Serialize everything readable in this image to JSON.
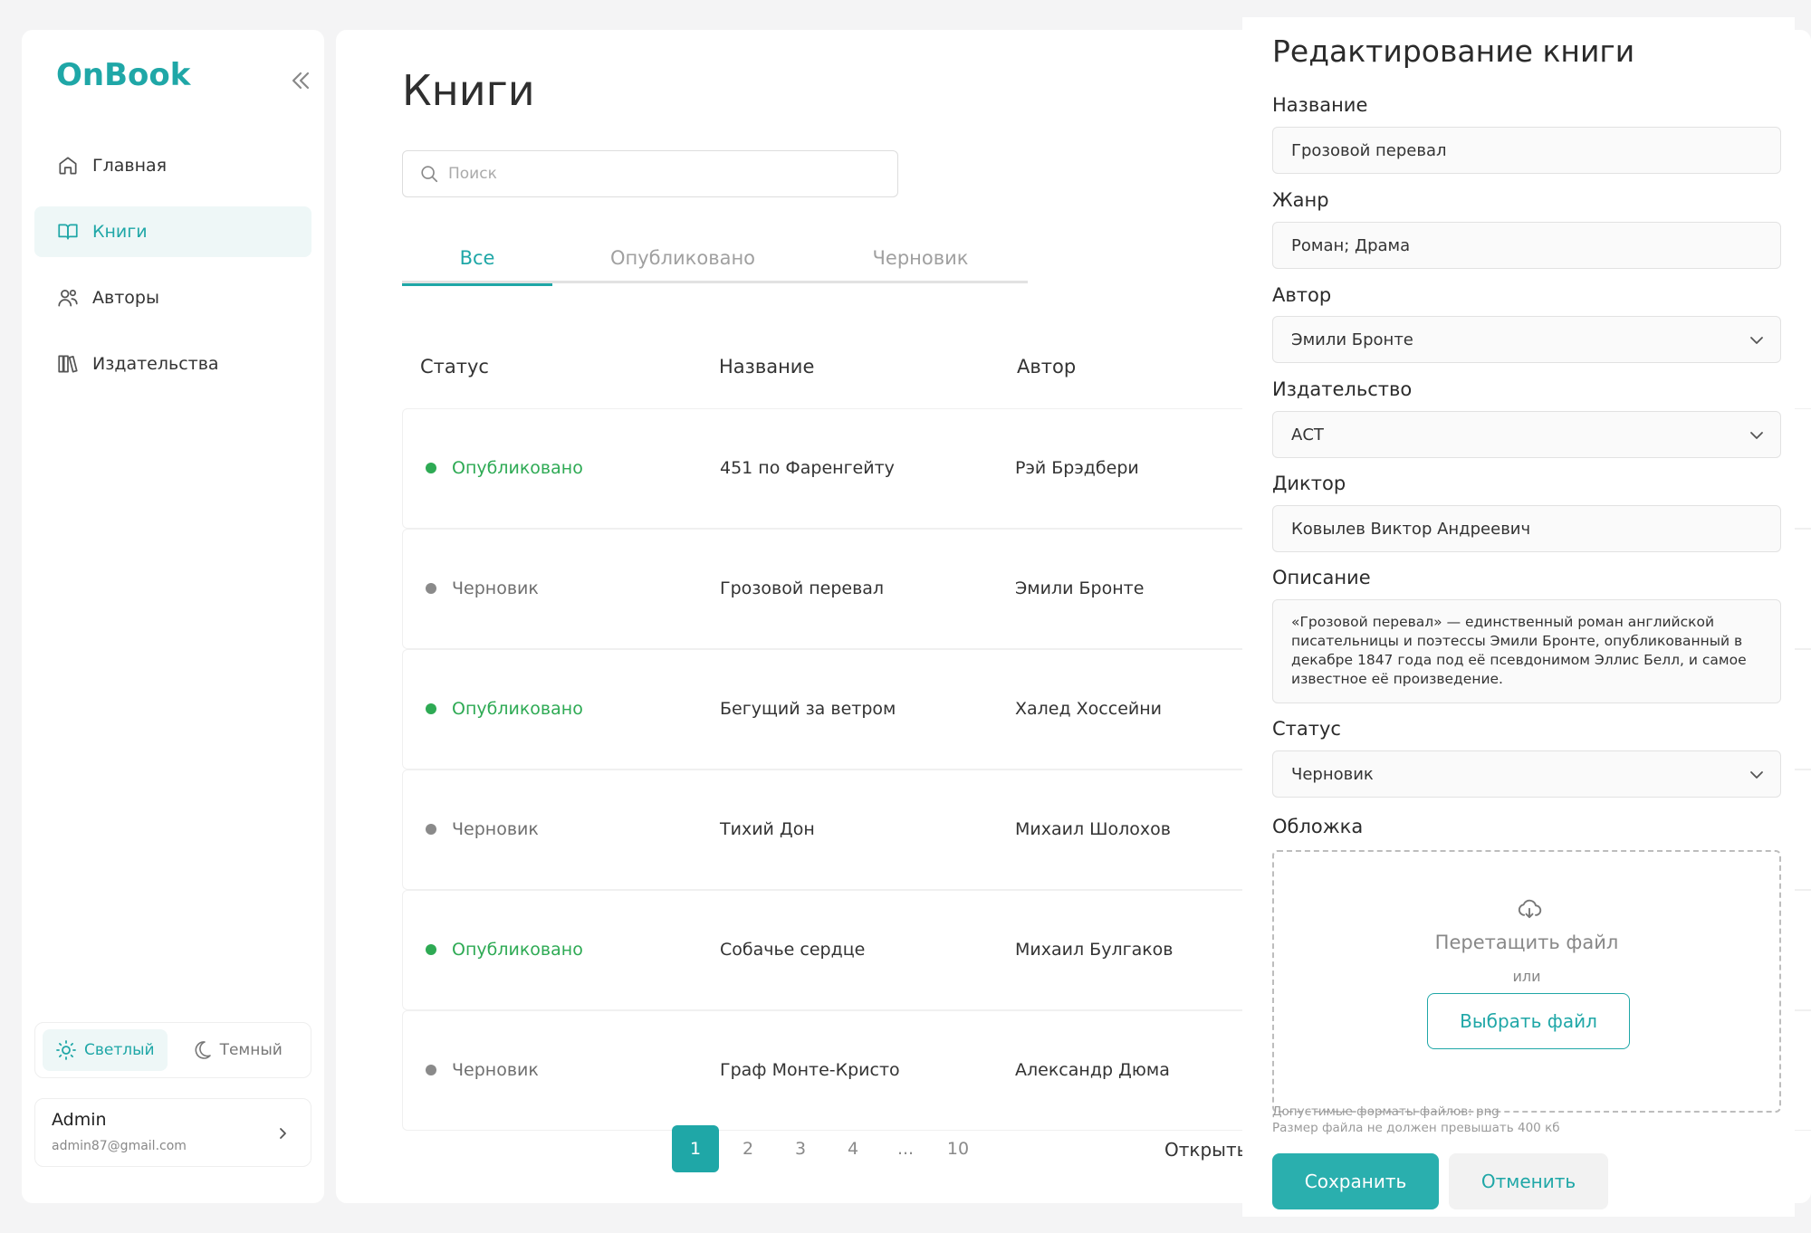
{
  "brand": {
    "name": "OnBook"
  },
  "sidebar": {
    "items": [
      {
        "label": "Главная",
        "icon": "home-icon"
      },
      {
        "label": "Книги",
        "icon": "book-icon"
      },
      {
        "label": "Авторы",
        "icon": "users-icon"
      },
      {
        "label": "Издательства",
        "icon": "library-icon"
      }
    ],
    "active_item": "Книги"
  },
  "theme": {
    "light": "Светлый",
    "dark": "Темный",
    "active": "Светлый"
  },
  "user": {
    "name": "Admin",
    "email": "admin87@gmail.com"
  },
  "main": {
    "title": "Книги",
    "search_placeholder": "Поиск",
    "tabs": [
      {
        "label": "Все"
      },
      {
        "label": "Опубликовано"
      },
      {
        "label": "Черновик"
      }
    ],
    "active_tab": "Все",
    "columns": [
      "Статус",
      "Название",
      "Автор"
    ],
    "rows": [
      {
        "status": "Опубликовано",
        "title": "451 по Фаренгейту",
        "author": "Рэй Брэдбери"
      },
      {
        "status": "Черновик",
        "title": "Грозовой перевал",
        "author": "Эмили Бронте"
      },
      {
        "status": "Опубликовано",
        "title": "Бегущий за ветром",
        "author": "Халед Хоссейни"
      },
      {
        "status": "Черновик",
        "title": "Тихий Дон",
        "author": "Михаил Шолохов"
      },
      {
        "status": "Опубликовано",
        "title": "Собачье сердце",
        "author": "Михаил Булгаков"
      },
      {
        "status": "Черновик",
        "title": "Граф Монте-Кристо",
        "author": "Александр Дюма"
      }
    ],
    "pagination": {
      "pages": [
        "1",
        "2",
        "3",
        "4",
        "...",
        "10"
      ],
      "current": "1"
    },
    "open_link": "Открыть"
  },
  "edit_panel": {
    "title": "Редактирование книги",
    "fields": {
      "name": {
        "label": "Название",
        "value": "Грозовой перевал"
      },
      "genre": {
        "label": "Жанр",
        "value": "Роман; Драма"
      },
      "author": {
        "label": "Автор",
        "value": "Эмили Бронте"
      },
      "publisher": {
        "label": "Издательство",
        "value": "АСТ"
      },
      "narrator": {
        "label": "Диктор",
        "value": "Ковылев Виктор Андреевич"
      },
      "description": {
        "label": "Описание",
        "value": "«Грозовой перевал» — единственный роман английской писательницы и поэтессы Эмили Бронте, опубликованный в декабре 1847 года под её псевдонимом Эллис Белл, и самое известное её произведение."
      },
      "status": {
        "label": "Статус",
        "value": "Черновик"
      }
    },
    "cover": {
      "label": "Обложка",
      "drop_text": "Перетащить файл",
      "or_text": "или",
      "choose_button": "Выбрать файл",
      "hint_formats": "Допустимые форматы файлов: png",
      "hint_size": "Размер файла не должен превышать 400 кб"
    },
    "save_button": "Сохранить",
    "cancel_button": "Отменить"
  },
  "colors": {
    "accent": "#1fa7a7",
    "published": "#2eaa54",
    "draft": "#8a8a8a"
  }
}
